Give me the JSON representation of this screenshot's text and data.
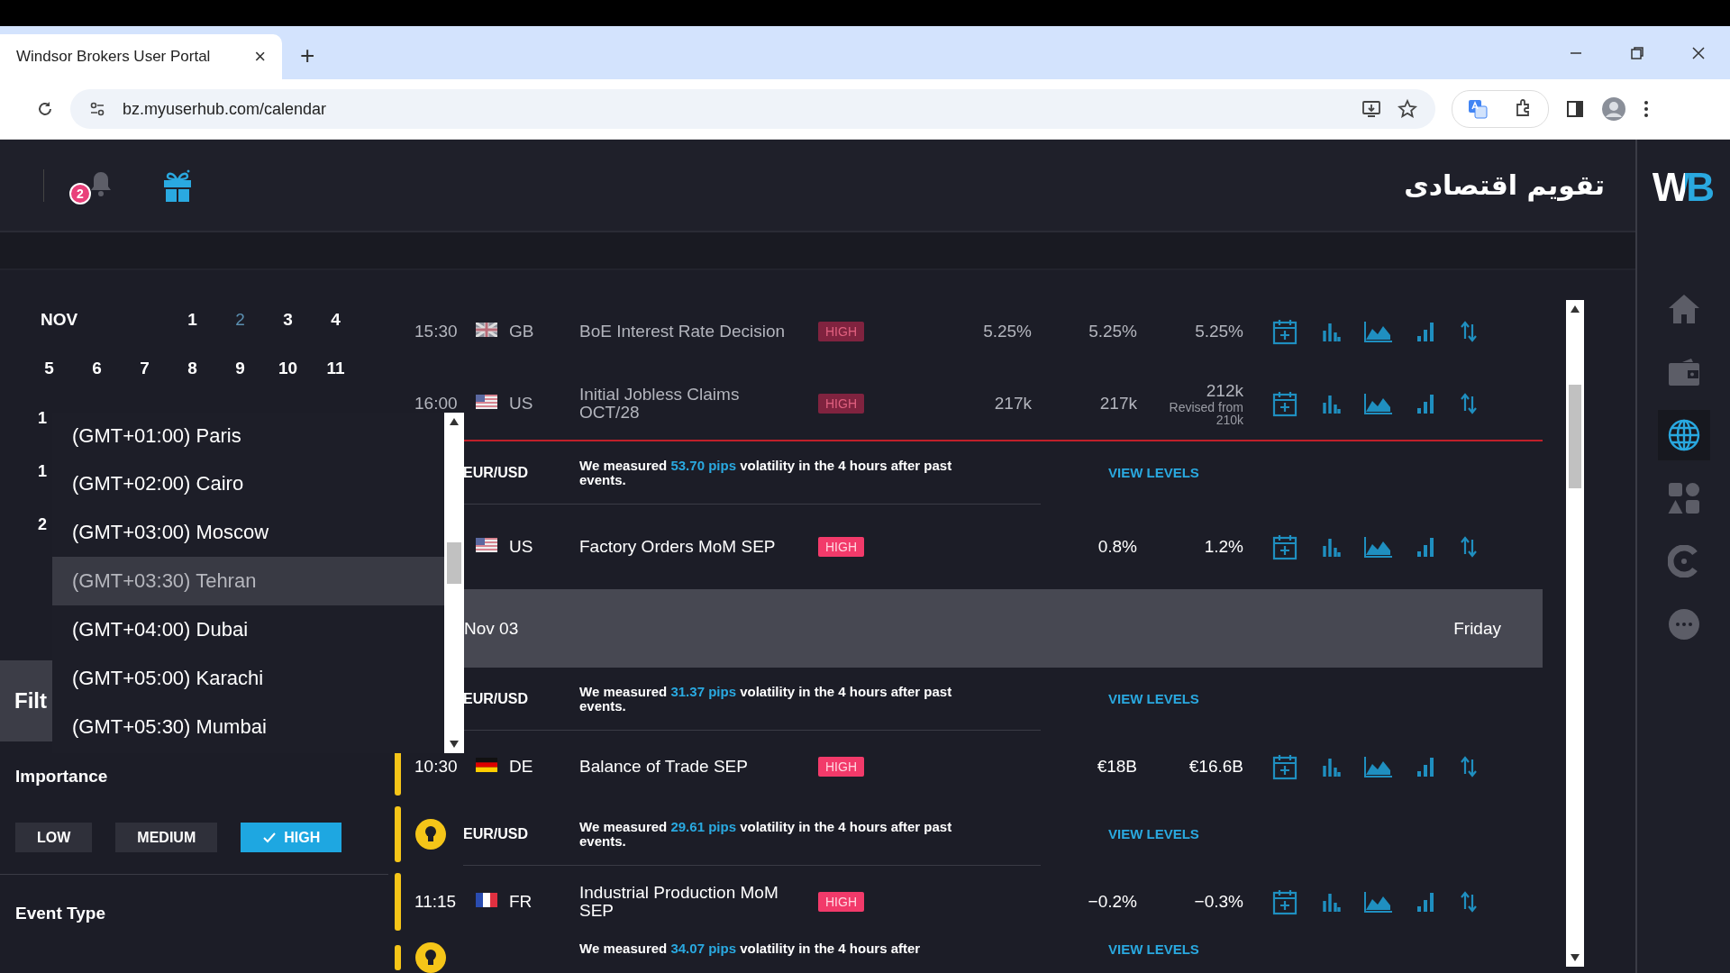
{
  "browser": {
    "tab_title": "Windsor Brokers User Portal",
    "tab_close": "×",
    "new_tab": "+",
    "url": "bz.myuserhub.com/calendar"
  },
  "header": {
    "title": "تقویم اقتصادی",
    "notification_count": "2"
  },
  "sidebar": {
    "logo": "WB",
    "items": [
      {
        "kind": "home",
        "selected": false
      },
      {
        "kind": "wallet",
        "selected": false
      },
      {
        "kind": "globe",
        "selected": true
      },
      {
        "kind": "shapes",
        "selected": false
      },
      {
        "kind": "ring",
        "selected": false
      },
      {
        "kind": "more",
        "selected": false
      }
    ]
  },
  "calendar": {
    "month": "NOV",
    "weeks": [
      [
        {
          "day": "1",
          "selected": false
        },
        {
          "day": "2",
          "selected": true
        },
        {
          "day": "3",
          "selected": false
        },
        {
          "day": "4",
          "selected": false
        }
      ],
      [
        {
          "day": "5",
          "selected": false
        },
        {
          "day": "6",
          "selected": false
        },
        {
          "day": "7",
          "selected": false
        },
        {
          "day": "8",
          "selected": false
        },
        {
          "day": "9",
          "selected": false
        },
        {
          "day": "10",
          "selected": false
        },
        {
          "day": "11",
          "selected": false
        }
      ]
    ]
  },
  "timezone_menu": {
    "row_marks": [
      "1",
      "1",
      "2"
    ],
    "options": [
      {
        "label": "(GMT+01:00) Paris",
        "selected": false
      },
      {
        "label": "(GMT+02:00) Cairo",
        "selected": false
      },
      {
        "label": "(GMT+03:00) Moscow",
        "selected": false
      },
      {
        "label": "(GMT+03:30) Tehran",
        "selected": true
      },
      {
        "label": "(GMT+04:00) Dubai",
        "selected": false
      },
      {
        "label": "(GMT+05:00) Karachi",
        "selected": false
      },
      {
        "label": "(GMT+05:30) Mumbai",
        "selected": false
      }
    ]
  },
  "filters": {
    "tab": "Filt",
    "importance_label": "Importance",
    "levels": [
      {
        "label": "LOW",
        "selected": false
      },
      {
        "label": "MEDIUM",
        "selected": false
      },
      {
        "label": "HIGH",
        "selected": true
      }
    ],
    "event_type_label": "Event Type"
  },
  "rows": [
    {
      "kind": "event",
      "time": "15:30",
      "flag": {
        "kind": "gb"
      },
      "country": "GB",
      "name": "BoE Interest Rate Decision",
      "importance": "HIGH",
      "past": true,
      "marker": false,
      "current_time_line": false,
      "actual": "5.25%",
      "forecast": "5.25%",
      "previous": "5.25%"
    },
    {
      "kind": "event",
      "time": "16:00",
      "flag": {
        "kind": "us"
      },
      "country": "US",
      "name": "Initial Jobless Claims OCT/28",
      "importance": "HIGH",
      "past": true,
      "marker": false,
      "current_time_line": true,
      "actual": "217k",
      "forecast": "217k",
      "previous": "212k",
      "revised": "Revised from 210k"
    },
    {
      "kind": "insight",
      "pair": "EUR/USD",
      "lead": "We measured",
      "pips": "53.70 pips",
      "tail": "volatility in the 4 hours after past events.",
      "action": "VIEW LEVELS",
      "bulb": false,
      "marker": false
    },
    {
      "kind": "event",
      "flag": {
        "kind": "us"
      },
      "country": "US",
      "name": "Factory Orders MoM SEP",
      "importance": "HIGH",
      "past": false,
      "marker": false,
      "current_time_line": false,
      "forecast": "0.8%",
      "previous": "1.2%"
    },
    {
      "kind": "date",
      "date": "Nov 03",
      "weekday": "Friday"
    },
    {
      "kind": "insight",
      "pair": "EUR/USD",
      "lead": "We measured",
      "pips": "31.37 pips",
      "tail": "volatility in the 4 hours after past events.",
      "action": "VIEW LEVELS",
      "bulb": false,
      "marker": false
    },
    {
      "kind": "event",
      "time": "10:30",
      "flag": {
        "kind": "de"
      },
      "country": "DE",
      "name": "Balance of Trade SEP",
      "importance": "HIGH",
      "past": false,
      "marker": true,
      "current_time_line": false,
      "forecast": "€18B",
      "previous": "€16.6B"
    },
    {
      "kind": "insight",
      "pair": "EUR/USD",
      "lead": "We measured",
      "pips": "29.61 pips",
      "tail": "volatility in the 4 hours after past events.",
      "action": "VIEW LEVELS",
      "bulb": true,
      "marker": true
    },
    {
      "kind": "event",
      "time": "11:15",
      "flag": {
        "kind": "fr"
      },
      "country": "FR",
      "name": "Industrial Production MoM SEP",
      "importance": "HIGH",
      "past": false,
      "marker": true,
      "current_time_line": false,
      "forecast": "−0.2%",
      "previous": "−0.3%"
    },
    {
      "kind": "insight",
      "lead": "We measured",
      "pips": "34.07 pips",
      "tail": "volatility in the 4 hours after",
      "action": "VIEW LEVELS",
      "bulb": true,
      "marker": true
    }
  ]
}
